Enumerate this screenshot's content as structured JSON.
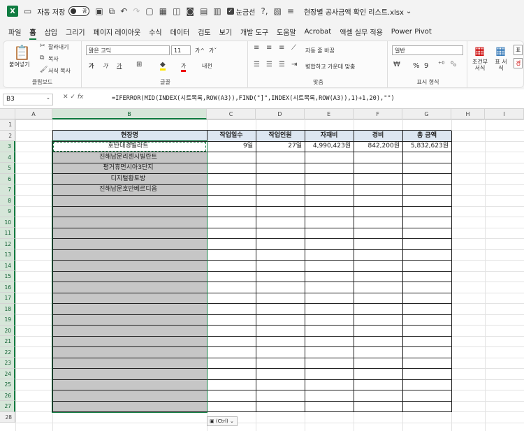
{
  "titlebar": {
    "autosave_label": "자동 저장",
    "autosave_state": "끔",
    "gridlines_label": "눈금선",
    "file_name": "현장별 공사금액 확인 리스트.xlsx"
  },
  "tabs": [
    "파일",
    "홈",
    "삽입",
    "그리기",
    "페이지 레이아웃",
    "수식",
    "데이터",
    "검토",
    "보기",
    "개발 도구",
    "도움말",
    "Acrobat",
    "액셀 실무 적용",
    "Power Pivot"
  ],
  "active_tab": "홈",
  "ribbon": {
    "clipboard": {
      "paste": "붙여넣기",
      "cut": "잘라내기",
      "copy": "복사",
      "format_painter": "서식 복사",
      "label": "클립보드"
    },
    "font": {
      "name": "맑은 고딕",
      "size": "11",
      "grow": "가^",
      "shrink": "가ˇ",
      "bold": "가",
      "italic": "가",
      "underline": "가",
      "color_letter": "가",
      "phonetic": "내천",
      "label": "글꼴"
    },
    "align": {
      "wrap": "자동 줄 바꿈",
      "merge": "병합하고 가운데 맞춤",
      "label": "맞춤"
    },
    "number": {
      "format": "일반",
      "percent": "%",
      "comma": "9",
      "label": "표시 형식"
    },
    "styles": {
      "conditional": "조건부 서식",
      "table": "표 서식",
      "cell1": "표",
      "cell2": "경"
    }
  },
  "formula_bar": {
    "name_box": "B3",
    "fx": "fx",
    "formula": "=IFERROR(MID(INDEX(시트목록,ROW(A3)),FIND(\"]\",INDEX(시트목록,ROW(A3)),1)+1,20),\"\")"
  },
  "columns": [
    "A",
    "B",
    "C",
    "D",
    "E",
    "F",
    "G",
    "H",
    "I"
  ],
  "rows": [
    "1",
    "2",
    "3",
    "4",
    "5",
    "6",
    "7",
    "8",
    "9",
    "10",
    "11",
    "12",
    "13",
    "14",
    "15",
    "16",
    "17",
    "18",
    "19",
    "20",
    "21",
    "22",
    "23",
    "24",
    "25",
    "26",
    "27",
    "28"
  ],
  "table": {
    "headers": [
      "현장명",
      "작업일수",
      "작업인원",
      "자재비",
      "경비",
      "총 금액"
    ],
    "rows": [
      [
        "호탄대경빌라트",
        "9일",
        "27일",
        "4,990,423원",
        "842,200원",
        "5,832,623원"
      ],
      [
        "진해남문리젠시빌란트",
        "",
        "",
        "",
        "",
        ""
      ],
      [
        "평거휴먼시아3단지",
        "",
        "",
        "",
        "",
        ""
      ],
      [
        "디지털황토방",
        "",
        "",
        "",
        "",
        ""
      ],
      [
        "진해남문호반베르디음",
        "",
        "",
        "",
        "",
        ""
      ]
    ]
  },
  "paste_options": "(Ctrl)",
  "colors": {
    "accent": "#107c41",
    "header_fill": "#dce6f1",
    "selection_fill": "#c6c6c6"
  }
}
